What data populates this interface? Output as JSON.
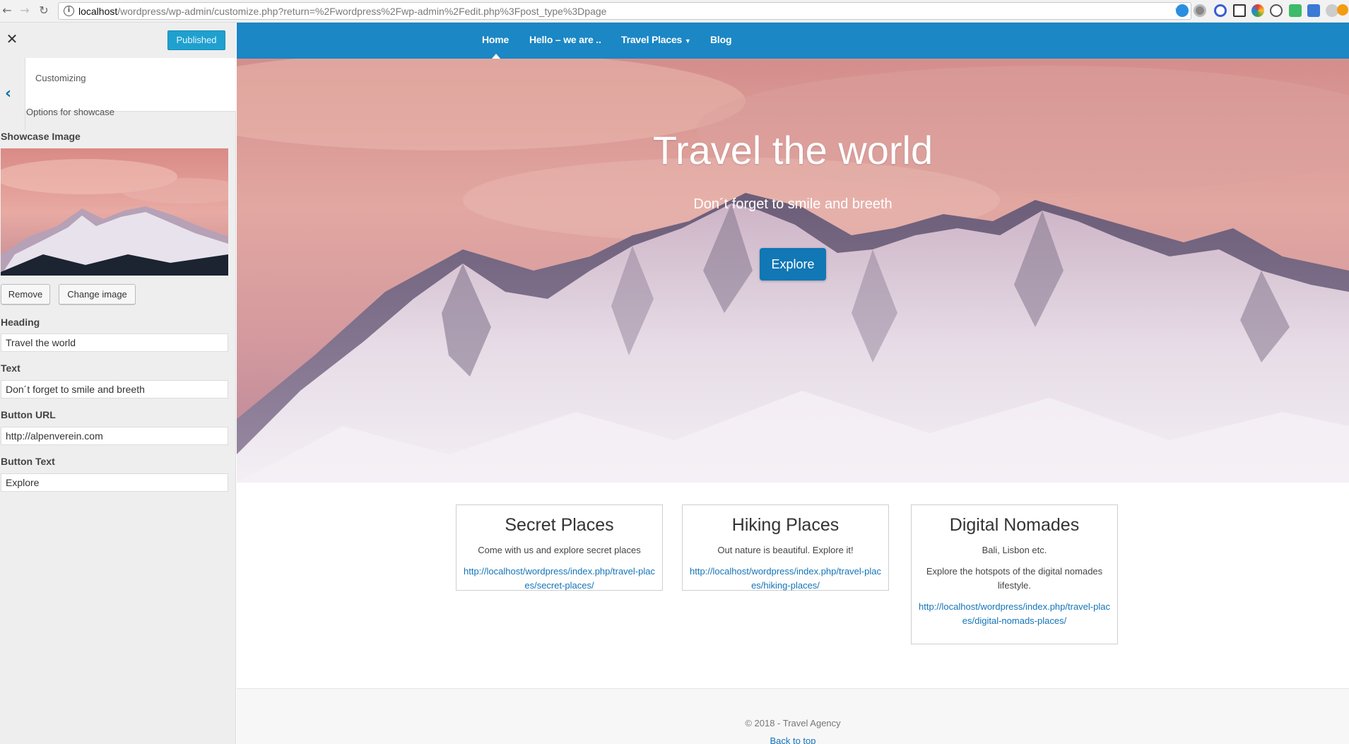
{
  "browser": {
    "url_host": "localhost",
    "url_path": "/wordpress/wp-admin/customize.php?return=%2Fwordpress%2Fwp-admin%2Fedit.php%3Fpost_type%3Dpage",
    "back_icon": "arrow-left-icon",
    "forward_icon": "arrow-right-icon",
    "reload_icon": "reload-icon"
  },
  "customizer": {
    "close_label": "✕",
    "publish_label": "Published",
    "section_title": "Customizing",
    "section_description": "Options for showcase",
    "image_label": "Showcase Image",
    "remove_label": "Remove",
    "change_image_label": "Change image",
    "heading_label": "Heading",
    "heading_value": "Travel the world",
    "text_label": "Text",
    "text_value": "Don´t forget to smile and breeth",
    "button_url_label": "Button URL",
    "button_url_value": "http://alpenverein.com",
    "button_text_label": "Button Text",
    "button_text_value": "Explore"
  },
  "site": {
    "nav": {
      "home": "Home",
      "hello": "Hello – we are ..",
      "travel_places": "Travel Places",
      "blog": "Blog"
    },
    "hero": {
      "title": "Travel the world",
      "text": "Don´t forget to smile and breeth",
      "button": "Explore"
    },
    "cards": [
      {
        "title": "Secret Places",
        "text": "Come with us and explore secret places",
        "link": "http://localhost/wordpress/index.php/travel-places/secret-places/"
      },
      {
        "title": "Hiking Places",
        "text": "Out nature is beautiful. Explore it!",
        "link": "http://localhost/wordpress/index.php/travel-places/hiking-places/"
      },
      {
        "title": "Digital Nomades",
        "text": "Bali, Lisbon etc.",
        "text2": "Explore the hotspots of the digital nomades lifestyle.",
        "link": "http://localhost/wordpress/index.php/travel-places/digital-nomads-places/"
      }
    ],
    "footer": {
      "copyright": "© 2018 - Travel Agency",
      "back_to_top": "Back to top"
    }
  },
  "colors": {
    "nav_bar": "#1b87c4",
    "publish_button": "#1fa0cf",
    "hero_button": "#1177b5",
    "link": "#1474b8"
  }
}
